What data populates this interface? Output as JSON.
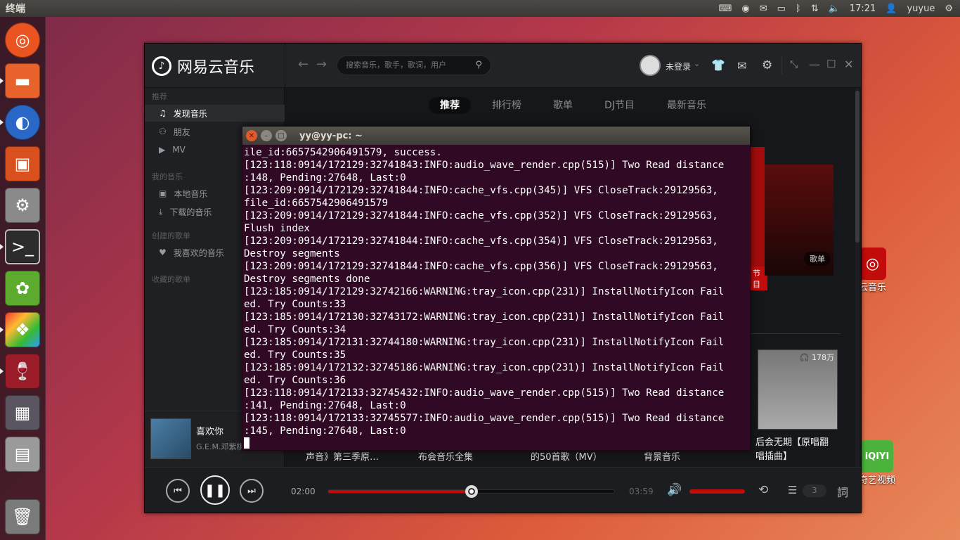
{
  "topbar": {
    "title": "终端",
    "time": "17:21",
    "user": "yuyue"
  },
  "launcher": {
    "items": [
      "ubuntu-dash",
      "files",
      "firefox",
      "ubuntu-software",
      "system-settings",
      "terminal",
      "ubuntu-tweak",
      "app-store",
      "wine",
      "workspace",
      "disk",
      "trash"
    ]
  },
  "desktop": {
    "icon1_label": "云音乐",
    "icon2_label": "奇艺视频"
  },
  "music": {
    "logo": "网易云音乐",
    "search_placeholder": "搜索音乐，歌手，歌词，用户",
    "login": "未登录",
    "sidebar": {
      "section1": "推荐",
      "discover": "发现音乐",
      "friends": "朋友",
      "mv": "MV",
      "section2": "我的音乐",
      "local": "本地音乐",
      "downloads": "下载的音乐",
      "section3": "创建的歌单",
      "liked": "我喜欢的音乐",
      "section4": "收藏的歌单"
    },
    "tabs": [
      "推荐",
      "排行榜",
      "歌单",
      "DJ节目",
      "最新音乐"
    ],
    "banner_tag": "歌单",
    "banner_tag2": "节目",
    "card_count": "178万",
    "card_title_l1": "后会无期【原唱翻",
    "card_title_l2": "唱插曲】",
    "row_titles": [
      "声音》第三季原…",
      "布会音乐全集",
      "的50首歌（MV）",
      "背景音乐"
    ],
    "now_playing": {
      "title": "喜欢你",
      "artist": "G.E.M.邓紫棋"
    },
    "player": {
      "elapsed": "02:00",
      "total": "03:59",
      "progress": 0.5,
      "volume": 1.0,
      "queue_count": "3"
    }
  },
  "terminal": {
    "title": "yy@yy-pc: ~",
    "lines": [
      "ile_id:6657542906491579, success.",
      "[123:118:0914/172129:32741843:INFO:audio_wave_render.cpp(515)] Two Read distance",
      ":148, Pending:27648, Last:0",
      "[123:209:0914/172129:32741844:INFO:cache_vfs.cpp(345)] VFS CloseTrack:29129563,",
      "file_id:6657542906491579",
      "[123:209:0914/172129:32741844:INFO:cache_vfs.cpp(352)] VFS CloseTrack:29129563,",
      "Flush index",
      "[123:209:0914/172129:32741844:INFO:cache_vfs.cpp(354)] VFS CloseTrack:29129563,",
      "Destroy segments",
      "[123:209:0914/172129:32741844:INFO:cache_vfs.cpp(356)] VFS CloseTrack:29129563,",
      "Destroy segments done",
      "[123:185:0914/172129:32742166:WARNING:tray_icon.cpp(231)] InstallNotifyIcon Fail",
      "ed. Try Counts:33",
      "[123:185:0914/172130:32743172:WARNING:tray_icon.cpp(231)] InstallNotifyIcon Fail",
      "ed. Try Counts:34",
      "[123:185:0914/172131:32744180:WARNING:tray_icon.cpp(231)] InstallNotifyIcon Fail",
      "ed. Try Counts:35",
      "[123:185:0914/172132:32745186:WARNING:tray_icon.cpp(231)] InstallNotifyIcon Fail",
      "ed. Try Counts:36",
      "[123:118:0914/172133:32745432:INFO:audio_wave_render.cpp(515)] Two Read distance",
      ":141, Pending:27648, Last:0",
      "[123:118:0914/172133:32745577:INFO:audio_wave_render.cpp(515)] Two Read distance",
      ":145, Pending:27648, Last:0"
    ]
  },
  "colors": {
    "accent": "#c20c0c",
    "terminal_bg": "#300a24"
  }
}
